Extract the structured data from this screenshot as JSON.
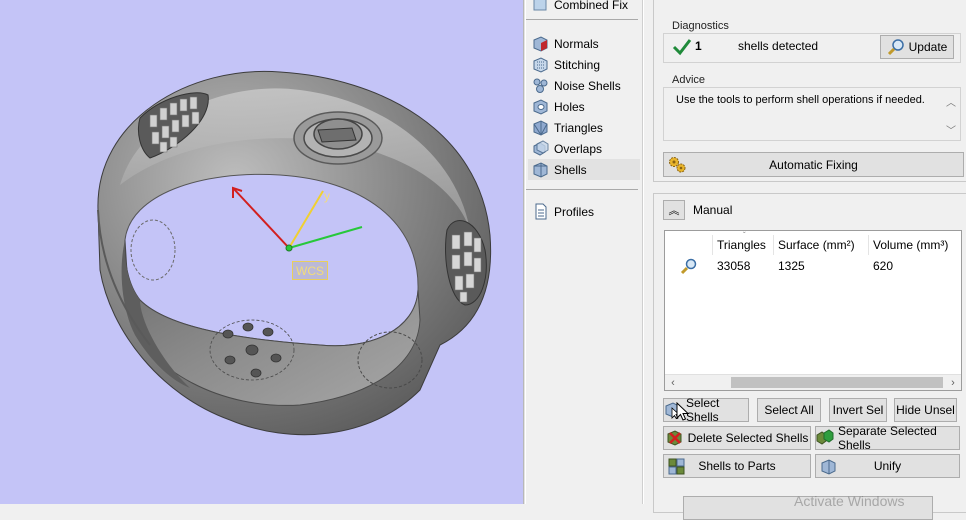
{
  "tree": {
    "top_item": "Combined Fix",
    "items": [
      {
        "label": "Normals",
        "icon": "normals-icon"
      },
      {
        "label": "Stitching",
        "icon": "stitching-icon"
      },
      {
        "label": "Noise Shells",
        "icon": "noise-shells-icon"
      },
      {
        "label": "Holes",
        "icon": "holes-icon"
      },
      {
        "label": "Triangles",
        "icon": "triangles-icon"
      },
      {
        "label": "Overlaps",
        "icon": "overlaps-icon"
      },
      {
        "label": "Shells",
        "icon": "shells-icon",
        "selected": true
      }
    ],
    "profiles": "Profiles"
  },
  "viewport": {
    "wcs_label": "WCS",
    "axis_y_label": "y",
    "background": "#c4c4f7"
  },
  "diagnostics": {
    "title": "Diagnostics",
    "count": "1",
    "message": "shells detected",
    "update_label": "Update"
  },
  "advice": {
    "title": "Advice",
    "text": "Use the tools to perform shell operations if needed."
  },
  "automatic_fixing_label": "Automatic Fixing",
  "manual": {
    "title": "Manual",
    "columns": [
      "Triangles",
      "Surface (mm²)",
      "Volume (mm³)"
    ],
    "rows": [
      {
        "triangles": "33058",
        "surface": "1325",
        "volume": "620"
      }
    ]
  },
  "buttons": {
    "select_shells": "Select Shells",
    "select_all": "Select All",
    "invert_sel": "Invert Sel",
    "hide_unsel": "Hide Unsel",
    "delete_selected": "Delete Selected Shells",
    "separate_selected": "Separate Selected Shells",
    "shells_to_parts": "Shells to Parts",
    "unify": "Unify"
  },
  "watermark": "Activate Windows",
  "colors": {
    "check": "#1f8a3a",
    "axis_x": "#d21f1f",
    "axis_y": "#f0d030",
    "axis_z": "#27c83a"
  }
}
